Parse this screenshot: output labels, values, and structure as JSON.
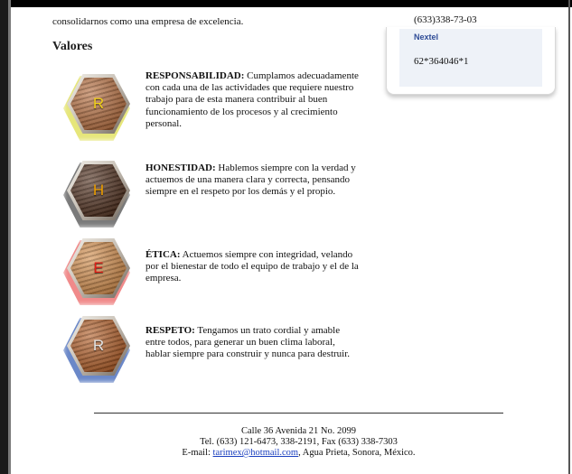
{
  "intro": {
    "line": "consolidarnos como una empresa de excelencia."
  },
  "section_title": "Valores",
  "values": [
    {
      "letter": "R",
      "heading": "RESPONSABILIDAD:",
      "text": " Cumplamos adecuadamente con cada una de las actividades que requiere nuestro trabajo para de esta manera contribuir al buen funcionamiento de los procesos y al crecimiento personal.",
      "letter_color": "#f4d21c",
      "glow_color": "#e6e67a",
      "wood_color": "#b46a3a"
    },
    {
      "letter": "H",
      "heading": "HONESTIDAD:",
      "text": " Hablemos siempre con la verdad y actuemos de una manera clara y correcta, pensando siempre en el respeto por los demás y el propio.",
      "letter_color": "#f0a000",
      "glow_color": "#7a7a7a",
      "wood_color": "#4b2a18"
    },
    {
      "letter": "E",
      "heading": "ÉTICA:",
      "text": " Actuemos siempre con integridad, velando por el bienestar de todo el equipo de trabajo y el de la empresa.",
      "letter_color": "#e11e16",
      "glow_color": "#f08a8a",
      "wood_color": "#d28b48"
    },
    {
      "letter": "R",
      "heading": "RESPETO:",
      "text": " Tengamos un trato cordial y amable entre todos, para generar un buen clima laboral, hablar siempre para construir y nunca para destruir.",
      "letter_color": "#e6e6e6",
      "glow_color": "#6b88c8",
      "wood_color": "#b05a22"
    }
  ],
  "contact": {
    "phone": "(633)338-73-03",
    "nextel_label": "Nextel",
    "nextel_number": "62*364046*1"
  },
  "footer": {
    "line1": "Calle 36 Avenida 21 No. 2099",
    "line2": "Tel. (633) 121-6473, 338-2191, Fax (633) 338-7303",
    "email_prefix": "E-mail: ",
    "email": "tarimex@hotmail.com",
    "email_suffix": ", Agua Prieta, Sonora, México."
  }
}
